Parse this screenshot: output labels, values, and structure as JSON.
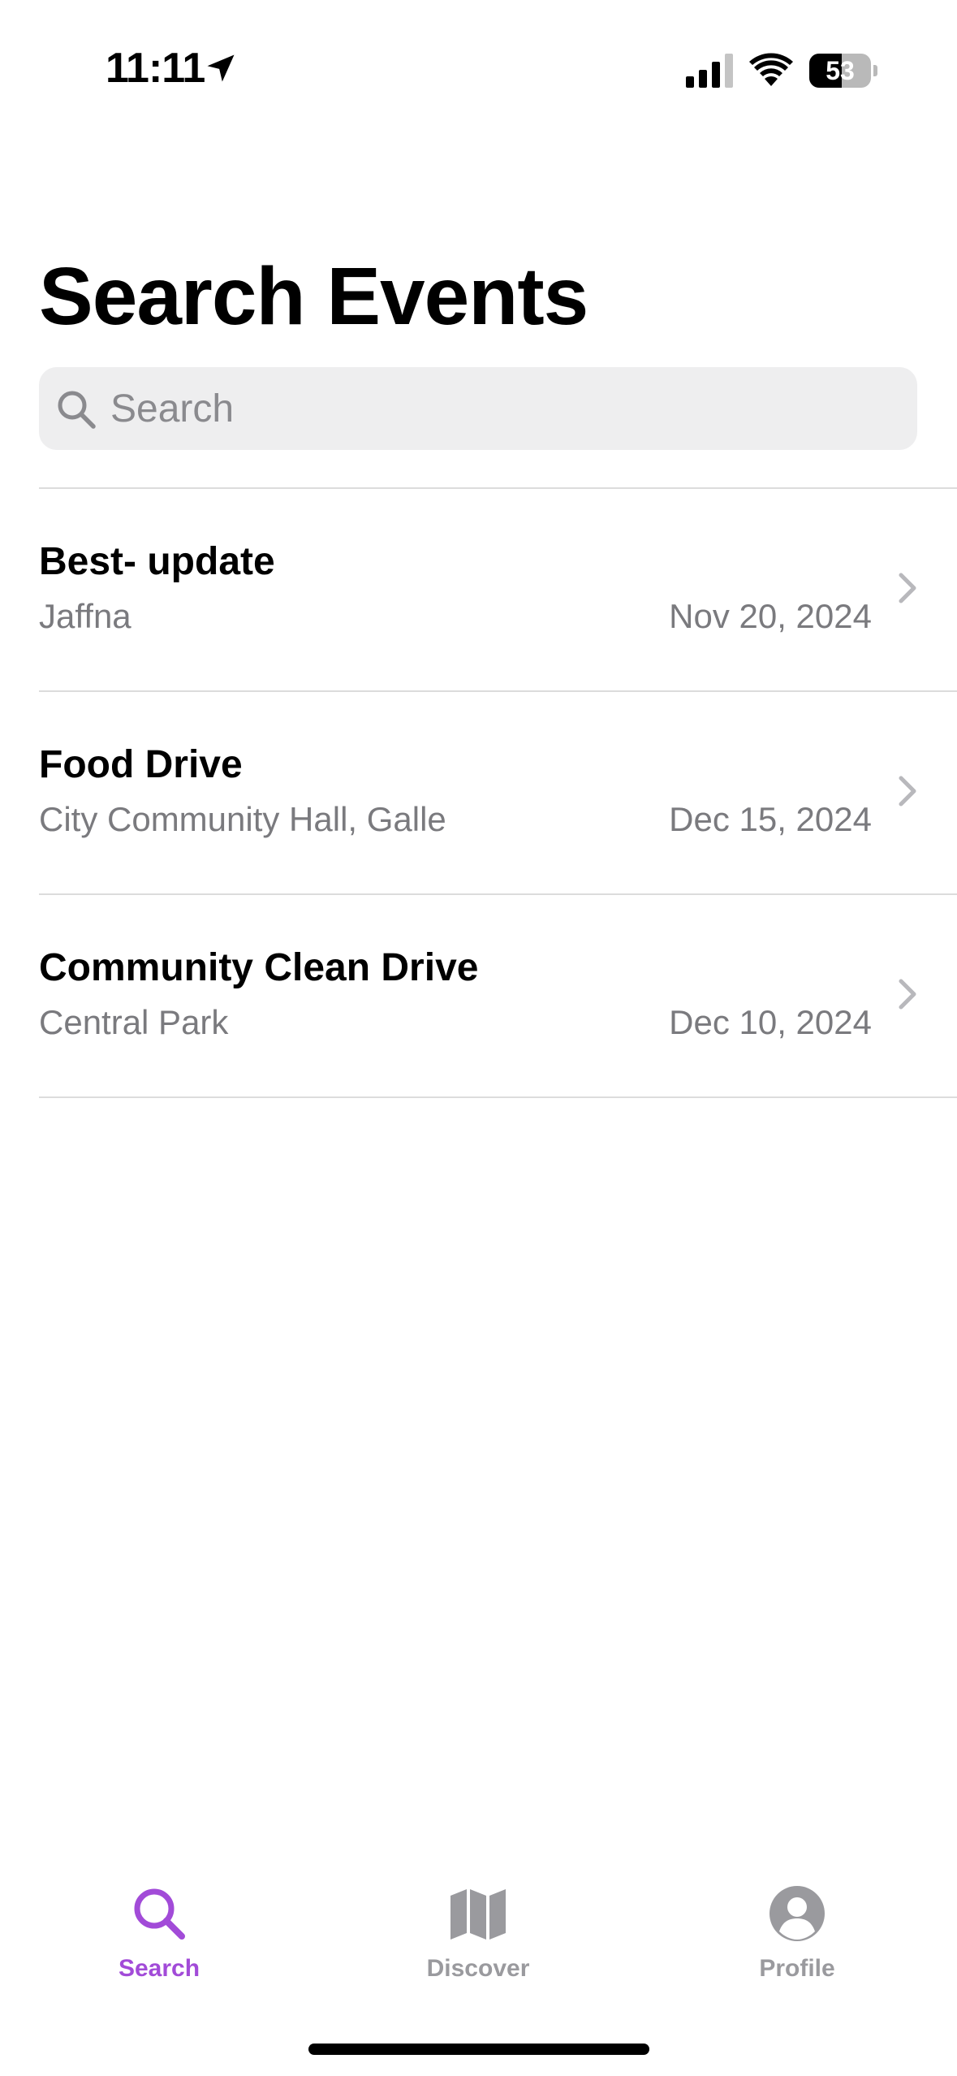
{
  "status_bar": {
    "time": "11:11",
    "battery_percent": "53",
    "battery_level": 0.53
  },
  "page": {
    "title": "Search Events"
  },
  "search": {
    "placeholder": "Search",
    "value": ""
  },
  "events": [
    {
      "title": "Best- update",
      "location": "Jaffna",
      "date": "Nov 20, 2024"
    },
    {
      "title": "Food Drive",
      "location": "City Community Hall, Galle",
      "date": "Dec 15, 2024"
    },
    {
      "title": "Community Clean Drive",
      "location": "Central Park",
      "date": "Dec 10, 2024"
    }
  ],
  "tab_bar": {
    "tabs": [
      {
        "label": "Search",
        "icon": "magnifier-icon",
        "active": true
      },
      {
        "label": "Discover",
        "icon": "map-icon",
        "active": false
      },
      {
        "label": "Profile",
        "icon": "person-circle-icon",
        "active": false
      }
    ]
  },
  "colors": {
    "accent": "#a24bd8",
    "inactive_tab": "#9a9a9e",
    "secondary_text": "#7a7a7e",
    "search_background": "#eeeeef"
  }
}
